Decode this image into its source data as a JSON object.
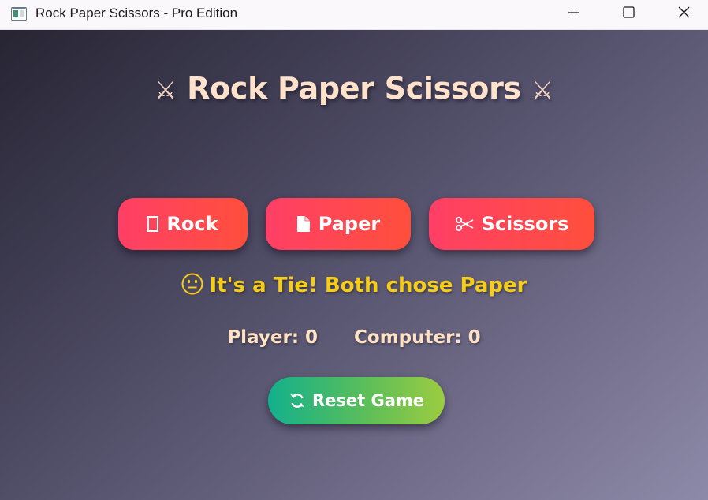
{
  "window": {
    "title": "Rock Paper Scissors - Pro Edition"
  },
  "game": {
    "heading_icon": "crossed-swords-icon",
    "heading": "Rock Paper Scissors",
    "choices": [
      {
        "label": "Rock",
        "icon": "rock-icon"
      },
      {
        "label": "Paper",
        "icon": "document-icon"
      },
      {
        "label": "Scissors",
        "icon": "scissors-icon"
      }
    ],
    "result": {
      "emoji": "neutral-face-icon",
      "text": "It's a Tie! Both chose Paper"
    },
    "score": {
      "player": "Player: 0",
      "computer": "Computer: 0"
    },
    "reset": {
      "label": "Reset Game",
      "icon": "refresh-icon"
    }
  },
  "colors": {
    "choice_gradient": [
      "#ff3f66",
      "#ff4f3c"
    ],
    "reset_gradient": [
      "#12b08c",
      "#9ccc40"
    ],
    "result_text": "#f5cc1a",
    "heading_text": "#ffe2cc",
    "background_gradient": [
      "#272533",
      "#8d89a8"
    ]
  }
}
